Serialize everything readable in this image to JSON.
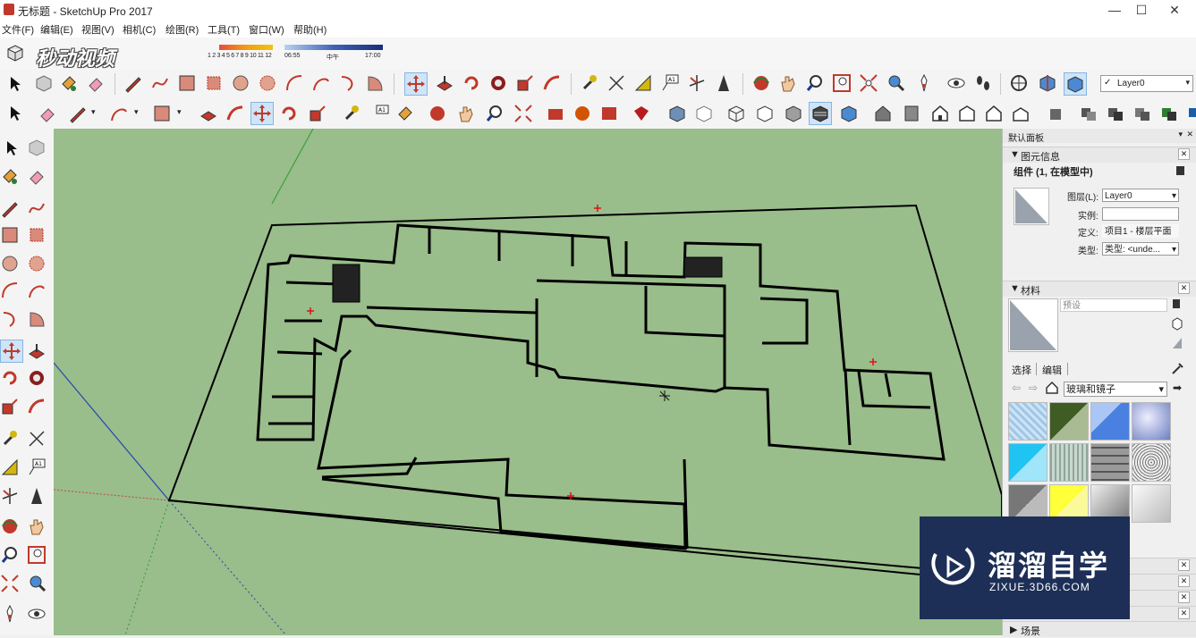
{
  "window": {
    "title": "无标题 - SketchUp Pro 2017",
    "minimize": "—",
    "maximize": "☐",
    "close": "✕"
  },
  "menu": [
    "文件(F)",
    "编辑(E)",
    "视图(V)",
    "相机(C)",
    "绘图(R)",
    "工具(T)",
    "窗口(W)",
    "帮助(H)"
  ],
  "shadow_bar": {
    "months": "1 2 3 4 5 6 7 8 9 10 11 12",
    "time_start": "06:55",
    "time_mid": "中午",
    "time_end": "17:00"
  },
  "layer_dropdown": "Layer0",
  "watermark_top_left": "秒动视频",
  "default_tray": {
    "title": "默认面板",
    "entity_info": {
      "header": "图元信息",
      "summary": "组件 (1, 在模型中)",
      "layer_label": "图层(L):",
      "layer_value": "Layer0",
      "instance_label": "实例:",
      "instance_value": "",
      "definition_label": "定义:",
      "definition_value": "项目1 - 楼层平面",
      "type_label": "类型:",
      "type_value": "类型: <unde..."
    },
    "materials": {
      "header": "材料",
      "preview_placeholder": "预设",
      "tab_select": "选择",
      "tab_edit": "编辑",
      "library": "玻璃和镜子"
    },
    "scenes_header": "场景"
  },
  "brand": {
    "name": "溜溜自学",
    "url": "ZIXUE.3D66.COM"
  },
  "colors": {
    "canvas": "#99bd8b",
    "brand_bg": "#1d2f57",
    "selected_tool": "#cfe4f7"
  }
}
